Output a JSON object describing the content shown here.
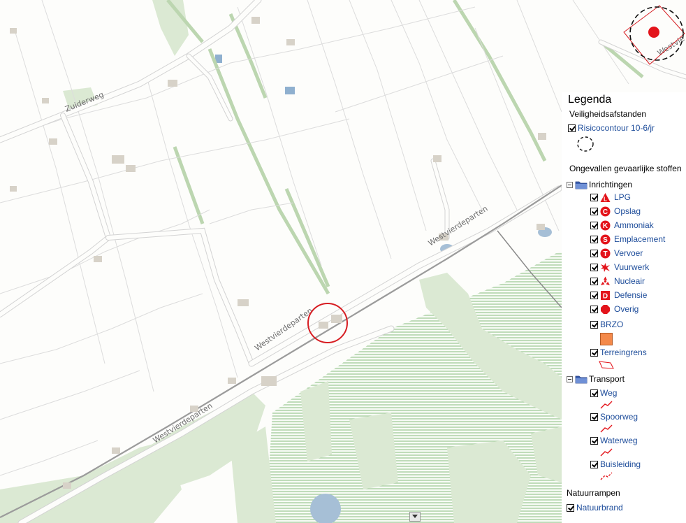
{
  "map": {
    "road_labels": [
      "Zuiderweg",
      "Westvierdeparten",
      "Westvierdeparten",
      "Westvierdeparten",
      "Westvie"
    ]
  },
  "legend": {
    "title": "Legenda",
    "section1": "Veiligheidsafstanden",
    "risicocontour": "Risicocontour 10-6/jr",
    "section2": "Ongevallen gevaarlijke stoffen",
    "inrichtingen": {
      "label": "Inrichtingen",
      "items": [
        {
          "label": "LPG",
          "icon": "lpg-triangle-icon",
          "letter": "L"
        },
        {
          "label": "Opslag",
          "icon": "opslag-icon",
          "letter": "C"
        },
        {
          "label": "Ammoniak",
          "icon": "ammoniak-icon",
          "letter": "K"
        },
        {
          "label": "Emplacement",
          "icon": "emplacement-icon",
          "letter": "S"
        },
        {
          "label": "Vervoer",
          "icon": "vervoer-icon",
          "letter": "T"
        },
        {
          "label": "Vuurwerk",
          "icon": "vuurwerk-icon",
          "letter": ""
        },
        {
          "label": "Nucleair",
          "icon": "nucleair-icon",
          "letter": ""
        },
        {
          "label": "Defensie",
          "icon": "defensie-icon",
          "letter": "D"
        },
        {
          "label": "Overig",
          "icon": "overig-octagon-icon",
          "letter": ""
        }
      ],
      "brzo": "BRZO",
      "terreingrens": "Terreingrens"
    },
    "transport": {
      "label": "Transport",
      "items": [
        "Weg",
        "Spoorweg",
        "Waterweg",
        "Buisleiding"
      ]
    },
    "section3": "Natuurrampen",
    "natuurbrand": "Natuurbrand"
  },
  "colors": {
    "icon_red": "#e3141b",
    "brzo_fill": "#f4894a",
    "link_blue": "#1d4c9a",
    "map_green": "#dbe9d3",
    "stripe_green": "#9cc894"
  }
}
